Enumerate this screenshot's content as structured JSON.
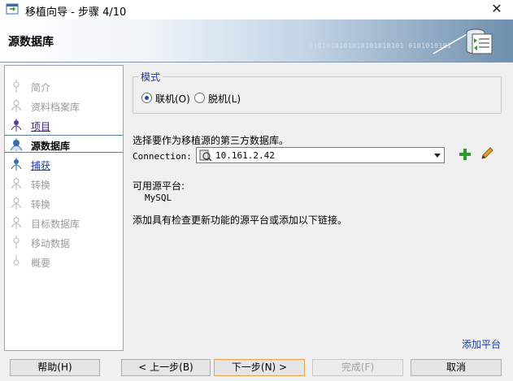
{
  "window": {
    "title": "移植向导 - 步骤 4/10",
    "close_symbol": "✕"
  },
  "banner": {
    "title": "源数据库",
    "binary_text": "0101010101010101010101  0101010101"
  },
  "nav": {
    "items": [
      {
        "label": "简介",
        "state": "disabled"
      },
      {
        "label": "资料档案库",
        "state": "disabled"
      },
      {
        "label": "项目",
        "state": "link"
      },
      {
        "label": "源数据库",
        "state": "active"
      },
      {
        "label": "捕获",
        "state": "link2"
      },
      {
        "label": "转换",
        "state": "disabled"
      },
      {
        "label": "转换",
        "state": "disabled"
      },
      {
        "label": "目标数据库",
        "state": "disabled"
      },
      {
        "label": "移动数据",
        "state": "disabled"
      },
      {
        "label": "概要",
        "state": "disabled"
      }
    ]
  },
  "modes": {
    "legend": "模式",
    "online_label": "联机(O)",
    "offline_label": "脱机(L)",
    "selected": "online"
  },
  "connection": {
    "prompt": "选择要作为移植源的第三方数据库。",
    "label": "Connection:",
    "value": "10.161.2.42"
  },
  "platform": {
    "label": "可用源平台:",
    "value": "MySQL",
    "help": "添加具有检查更新功能的源平台或添加以下链接。"
  },
  "links": {
    "add_platform": "添加平台"
  },
  "buttons": {
    "help": "帮助(H)",
    "back": "< 上一步(B)",
    "next": "下一步(N) >",
    "finish": "完成(F)",
    "cancel": "取消"
  },
  "colors": {
    "accent_blue": "#1a3aa8",
    "add_green": "#2e9a2e",
    "default_button_border": "#e8a14e"
  }
}
